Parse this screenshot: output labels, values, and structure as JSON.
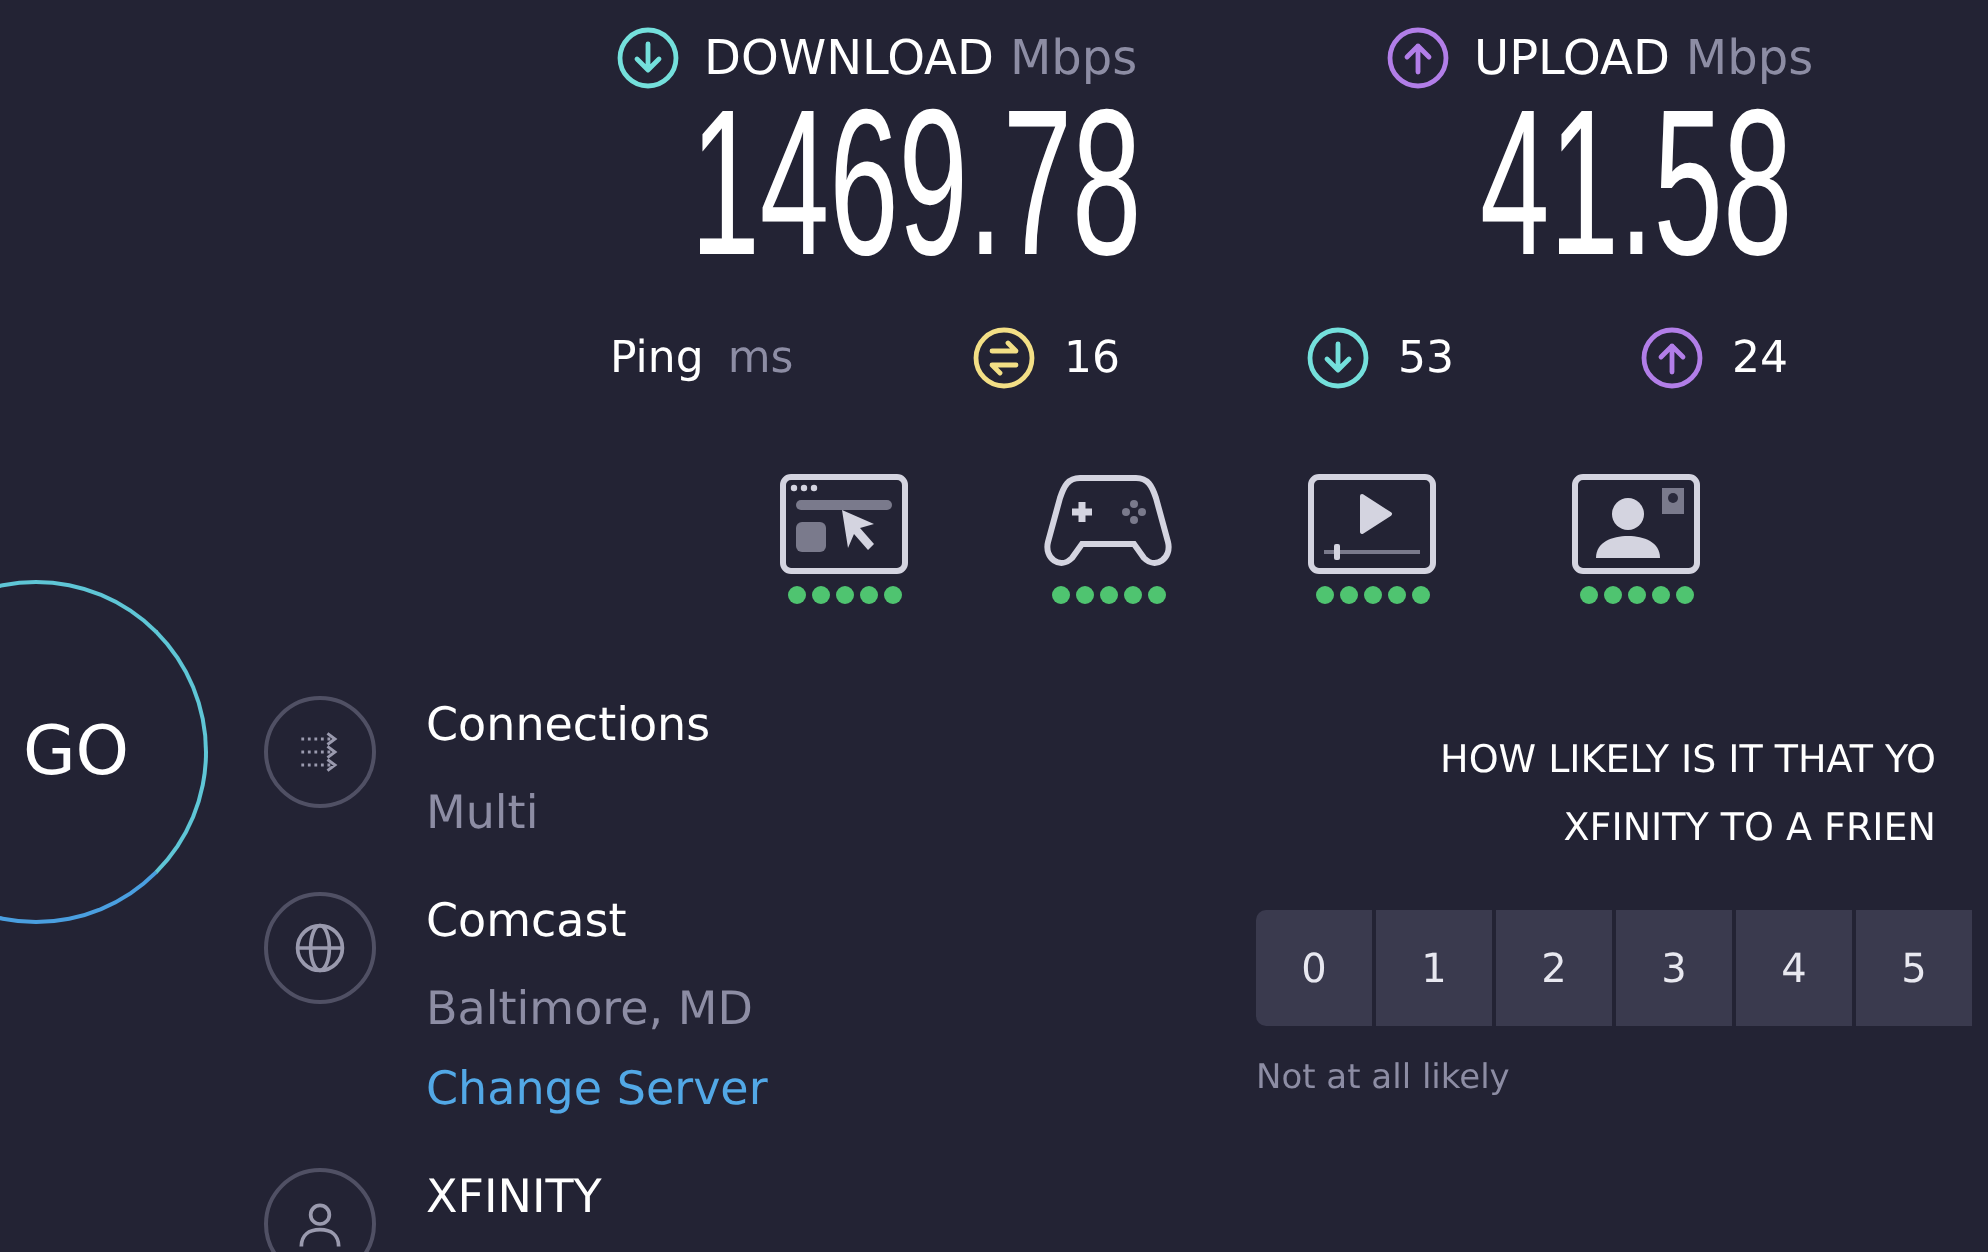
{
  "speeds": [
    {
      "kind": "download",
      "label": "DOWNLOAD",
      "unit": "Mbps",
      "value": "1469.78"
    },
    {
      "kind": "upload",
      "label": "UPLOAD",
      "unit": "Mbps",
      "value": "41.58"
    }
  ],
  "ping": {
    "label": "Ping",
    "unit": "ms",
    "values": [
      {
        "kind": "idle",
        "value": "16"
      },
      {
        "kind": "download",
        "value": "53"
      },
      {
        "kind": "upload",
        "value": "24"
      }
    ]
  },
  "ratings": [
    {
      "kind": "browsing",
      "stars": 5
    },
    {
      "kind": "gaming",
      "stars": 5
    },
    {
      "kind": "streaming",
      "stars": 5
    },
    {
      "kind": "video_chat",
      "stars": 5
    }
  ],
  "go_button": "GO",
  "info": [
    {
      "kind": "connections",
      "title": "Connections",
      "subtitle": "Multi"
    },
    {
      "kind": "server",
      "title": "Comcast",
      "subtitle": "Baltimore, MD",
      "link": "Change Server"
    },
    {
      "kind": "provider",
      "title": "XFINITY"
    }
  ],
  "survey": {
    "question_lines": [
      "HOW LIKELY IS IT THAT YO",
      "XFINITY TO A FRIEN"
    ],
    "options": [
      "0",
      "1",
      "2",
      "3",
      "4",
      "5"
    ],
    "low_label": "Not at all likely"
  }
}
